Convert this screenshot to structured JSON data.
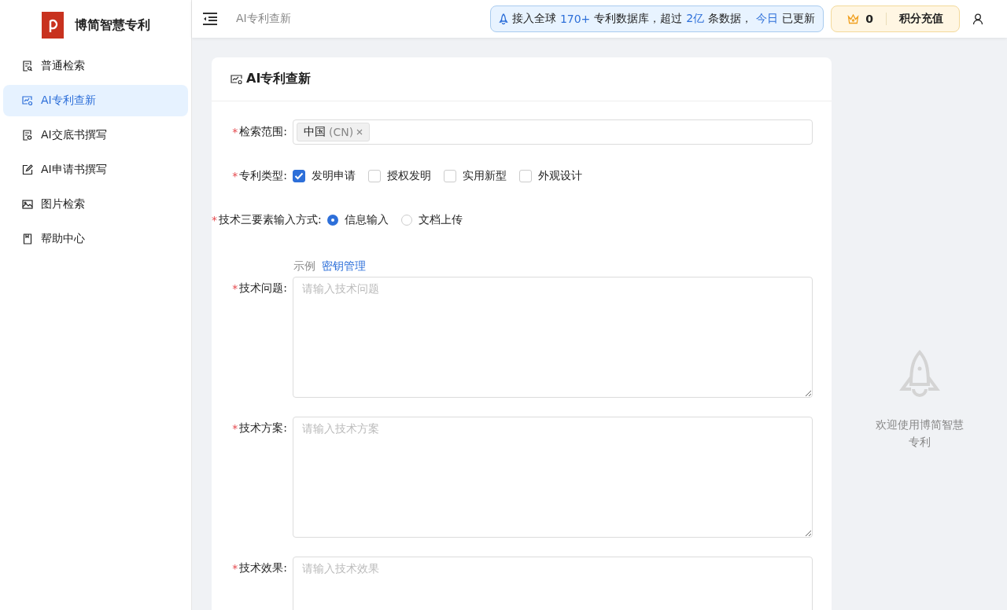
{
  "brand": {
    "name": "博简智慧专利"
  },
  "sidebar": {
    "items": [
      {
        "label": "普通检索",
        "selected": false
      },
      {
        "label": "AI专利查新",
        "selected": true
      },
      {
        "label": "AI交底书撰写",
        "selected": false
      },
      {
        "label": "AI申请书撰写",
        "selected": false
      },
      {
        "label": "图片检索",
        "selected": false
      },
      {
        "label": "帮助中心",
        "selected": false
      }
    ]
  },
  "header": {
    "breadcrumb": "AI专利查新",
    "notice": [
      {
        "text": "接入全球",
        "highlight": false
      },
      {
        "text": "170+",
        "highlight": true
      },
      {
        "text": "专利数据库，超过",
        "highlight": false
      },
      {
        "text": "2亿",
        "highlight": true
      },
      {
        "text": "条数据，",
        "highlight": false
      },
      {
        "text": "今日",
        "highlight": true
      },
      {
        "text": "已更新",
        "highlight": false
      }
    ],
    "points": "0",
    "recharge": "积分充值"
  },
  "card": {
    "title": "AI专利查新",
    "scope": {
      "mark": "*",
      "label": "检索范围:",
      "tags": [
        {
          "name": "中国",
          "code": "(CN)"
        }
      ]
    },
    "types": {
      "mark": "*",
      "label": "专利类型:",
      "options": [
        {
          "label": "发明申请",
          "checked": true
        },
        {
          "label": "授权发明",
          "checked": false
        },
        {
          "label": "实用新型",
          "checked": false
        },
        {
          "label": "外观设计",
          "checked": false
        }
      ]
    },
    "mode": {
      "mark": "*",
      "label": "技术三要素输入方式:",
      "options": [
        {
          "label": "信息输入",
          "selected": true
        },
        {
          "label": "文档上传",
          "selected": false
        }
      ]
    },
    "links": [
      {
        "label": "示例",
        "kind": "plain"
      },
      {
        "label": "密钥管理",
        "kind": "link"
      }
    ],
    "fields": [
      {
        "mark": "*",
        "label": "技术问题:",
        "placeholder": "请输入技术问题"
      },
      {
        "mark": "*",
        "label": "技术方案:",
        "placeholder": "请输入技术方案"
      },
      {
        "mark": "*",
        "label": "技术效果:",
        "placeholder": "请输入技术效果"
      }
    ]
  },
  "welcome": {
    "text": "欢迎使用博简智慧专利"
  }
}
